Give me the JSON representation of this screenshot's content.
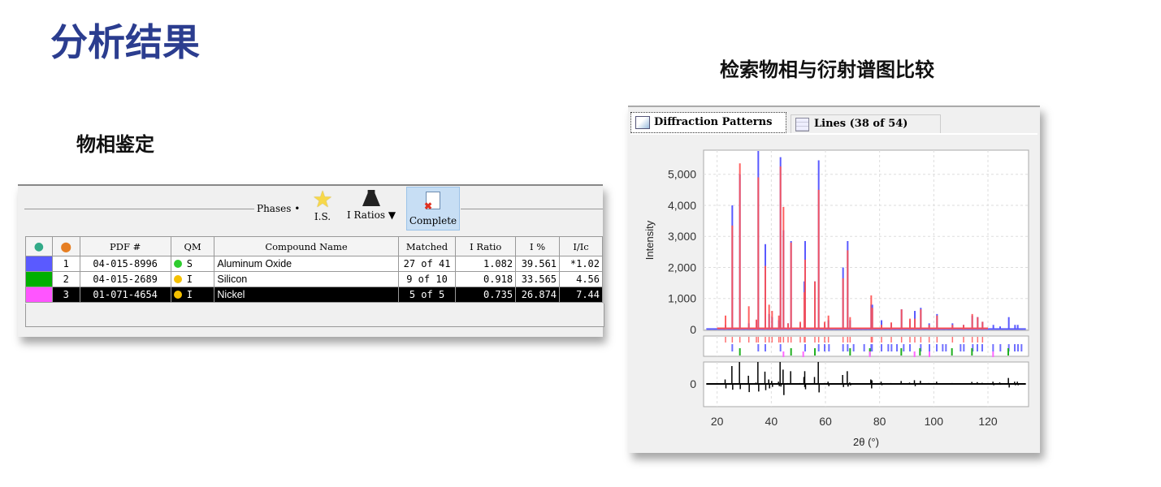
{
  "slide": {
    "title": "分析结果",
    "left_caption": "物相鉴定",
    "right_caption": "检索物相与衍射谱图比较"
  },
  "phases_panel": {
    "group_label": "Phases",
    "toolbar": {
      "is_label": "I.S.",
      "i_ratios_label": "I Ratios",
      "complete_label": "Complete"
    },
    "columns": [
      "",
      "",
      "PDF #",
      "QM",
      "Compound Name",
      "Matched",
      "I Ratio",
      "I %",
      "I/Ic"
    ],
    "rows": [
      {
        "color": "#5a5aff",
        "index": "1",
        "pdf": "04-015-8996",
        "qm_color": "#2ecc2e",
        "qm": "S",
        "name": "Aluminum Oxide",
        "matched": "27 of 41",
        "i_ratio": "1.082",
        "i_pct": "39.561",
        "i_ic": "*1.02",
        "selected": false
      },
      {
        "color": "#00b000",
        "index": "2",
        "pdf": "04-015-2689",
        "qm_color": "#f5c000",
        "qm": "I",
        "name": "Silicon",
        "matched": "9 of 10",
        "i_ratio": "0.918",
        "i_pct": "33.565",
        "i_ic": "4.56",
        "selected": false
      },
      {
        "color": "#ff55ff",
        "index": "3",
        "pdf": "01-071-4654",
        "qm_color": "#f5c000",
        "qm": "I",
        "name": "Nickel",
        "matched": "5 of 5",
        "i_ratio": "0.735",
        "i_pct": "26.874",
        "i_ic": "7.44",
        "selected": true
      }
    ]
  },
  "diffraction_panel": {
    "tabs": [
      {
        "label": "Diffraction Patterns",
        "active": true
      },
      {
        "label": "Lines (38 of 54)",
        "active": false
      }
    ]
  },
  "chart_data": {
    "type": "line",
    "xlabel": "2θ (°)",
    "ylabel": "Intensity",
    "xlim": [
      15,
      135
    ],
    "ylim": [
      0,
      5750
    ],
    "xticks": [
      "20",
      "40",
      "60",
      "80",
      "100",
      "120"
    ],
    "yticks": [
      "0",
      "1,000",
      "2,000",
      "3,000",
      "4,000",
      "5,000"
    ],
    "diff_yticks": [
      "0"
    ],
    "grid": true,
    "colors": {
      "observed": "#5a5aff",
      "calculated": "#ff5050",
      "difference": "#000000"
    },
    "peaks": [
      [
        23.1,
        150,
        450
      ],
      [
        25.6,
        4000,
        3350
      ],
      [
        28.4,
        5000,
        5350
      ],
      [
        31.7,
        200,
        750
      ],
      [
        34.5,
        300,
        320
      ],
      [
        35.2,
        5750,
        4900
      ],
      [
        37.8,
        2750,
        2050
      ],
      [
        39.2,
        500,
        800
      ],
      [
        40.3,
        400,
        600
      ],
      [
        42.8,
        300,
        450
      ],
      [
        43.4,
        5550,
        5250
      ],
      [
        44.5,
        3200,
        3950
      ],
      [
        46.2,
        200,
        200
      ],
      [
        47.3,
        2850,
        2800
      ],
      [
        50.7,
        200,
        250
      ],
      [
        52.2,
        1550,
        1200
      ],
      [
        52.5,
        2850,
        2250
      ],
      [
        56.1,
        1550,
        1550
      ],
      [
        57.5,
        5450,
        4500
      ],
      [
        59.7,
        200,
        250
      ],
      [
        61.1,
        300,
        450
      ],
      [
        66.5,
        2000,
        1650
      ],
      [
        68.2,
        2850,
        2550
      ],
      [
        69.1,
        300,
        400
      ],
      [
        76.9,
        800,
        1100
      ],
      [
        77.3,
        800,
        700
      ],
      [
        80.7,
        300,
        150
      ],
      [
        84.3,
        200,
        230
      ],
      [
        88.1,
        650,
        650
      ],
      [
        91.2,
        300,
        350
      ],
      [
        93.0,
        600,
        350
      ],
      [
        95.2,
        700,
        650
      ],
      [
        98.3,
        200,
        150
      ],
      [
        101.2,
        500,
        450
      ],
      [
        106.9,
        200,
        150
      ],
      [
        111.0,
        150,
        150
      ],
      [
        114.2,
        450,
        500
      ],
      [
        116.2,
        400,
        400
      ],
      [
        118.0,
        250,
        250
      ],
      [
        122.0,
        150,
        0
      ],
      [
        124.5,
        100,
        0
      ],
      [
        127.7,
        400,
        0
      ],
      [
        130.0,
        150,
        0
      ],
      [
        131.0,
        150,
        0
      ]
    ],
    "reference_lines": {
      "Aluminum Oxide": [
        25.6,
        35.2,
        37.8,
        43.4,
        52.5,
        57.5,
        59.7,
        61.3,
        66.5,
        68.2,
        70.4,
        74.3,
        76.9,
        77.2,
        80.7,
        83.2,
        84.4,
        86.4,
        88.9,
        91.2,
        95.2,
        98.4,
        101.1,
        103.3,
        104.5,
        109.9,
        111.1,
        114.4,
        116.1,
        117.9,
        121.9,
        124.6,
        127.7,
        129.9,
        131.1,
        132.4
      ],
      "Silicon": [
        28.4,
        47.3,
        56.1,
        69.1,
        76.4,
        88.0,
        94.9,
        106.7,
        114.1,
        127.5
      ],
      "Nickel": [
        44.5,
        51.8,
        76.4,
        92.9,
        98.4,
        121.9
      ]
    }
  }
}
